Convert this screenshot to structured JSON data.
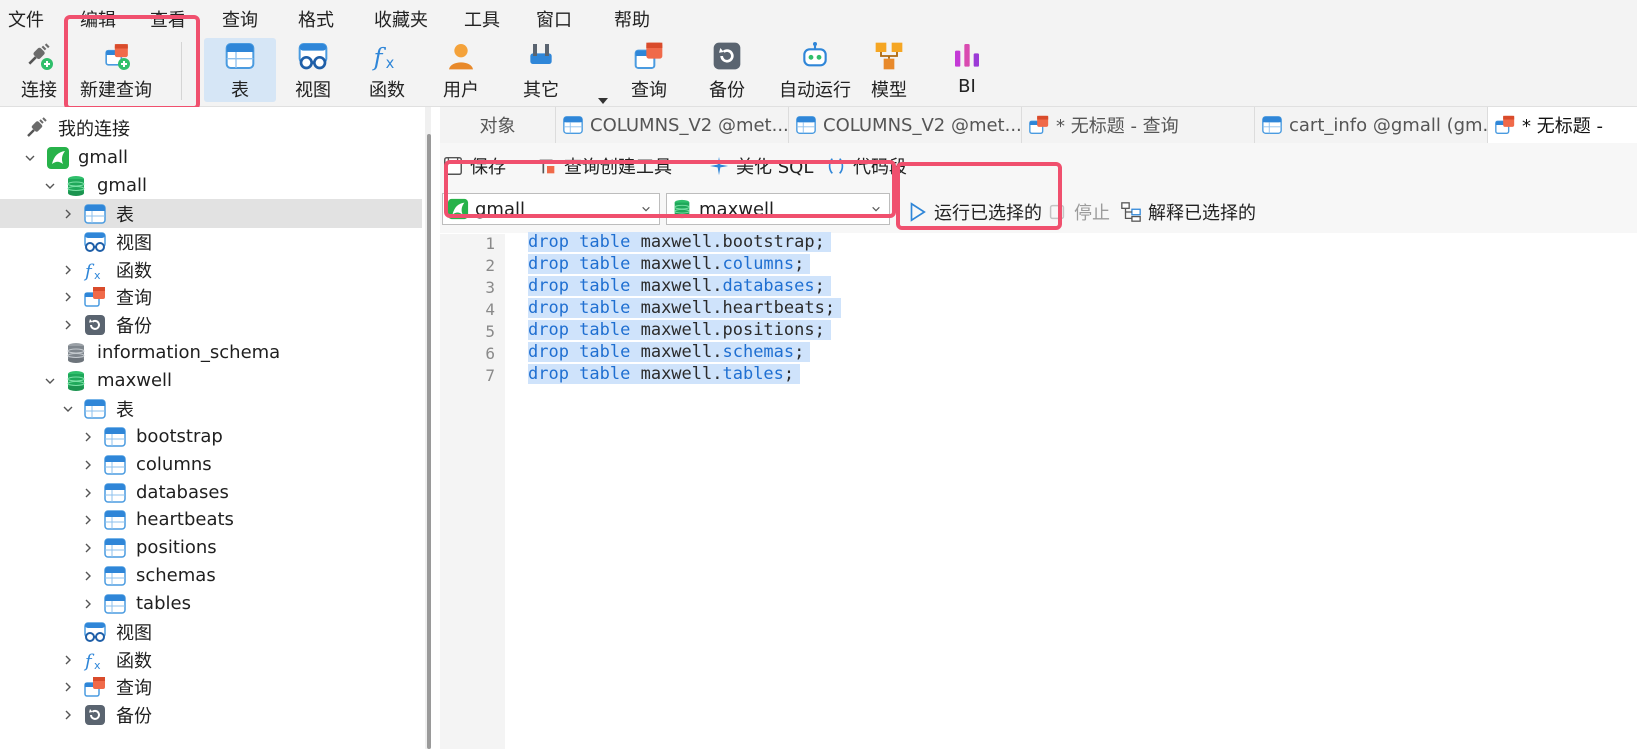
{
  "menu": [
    "文件",
    "编辑",
    "查看",
    "查询",
    "格式",
    "收藏夹",
    "工具",
    "窗口",
    "帮助"
  ],
  "toolbar": {
    "connect": "连接",
    "new_query": "新建查询",
    "table": "表",
    "view": "视图",
    "function": "函数",
    "user": "用户",
    "other": "其它",
    "query": "查询",
    "backup": "备份",
    "auto_run": "自动运行",
    "model": "模型",
    "bi": "BI"
  },
  "sidebar": {
    "root": "我的连接",
    "conn": "gmall",
    "db_gmall": "gmall",
    "tables": "表",
    "views": "视图",
    "functions": "函数",
    "queries": "查询",
    "backups": "备份",
    "info_schema": "information_schema",
    "db_maxwell": "maxwell",
    "mx_tables": "表",
    "mx_table_list": [
      "bootstrap",
      "columns",
      "databases",
      "heartbeats",
      "positions",
      "schemas",
      "tables"
    ],
    "mx_views": "视图",
    "mx_functions": "函数",
    "mx_queries": "查询",
    "mx_backups": "备份"
  },
  "tabs": [
    "对象",
    "COLUMNS_V2 @met...",
    "COLUMNS_V2 @met...",
    "* 无标题 - 查询",
    "cart_info @gmall (gm...",
    "* 无标题 -"
  ],
  "query_toolbar": {
    "save": "保存",
    "builder": "查询创建工具",
    "beautify": "美化 SQL",
    "snippet": "代码段"
  },
  "query_bar": {
    "connection": "gmall",
    "database": "maxwell",
    "run_selected": "运行已选择的",
    "stop": "停止",
    "explain_selected": "解释已选择的"
  },
  "editor": {
    "lines": [
      {
        "n": "1",
        "kw": "drop table",
        "obj": "maxwell.",
        "name": "bootstrap",
        "name_kw": false
      },
      {
        "n": "2",
        "kw": "drop table",
        "obj": "maxwell.",
        "name": "columns",
        "name_kw": true
      },
      {
        "n": "3",
        "kw": "drop table",
        "obj": "maxwell.",
        "name": "databases",
        "name_kw": true
      },
      {
        "n": "4",
        "kw": "drop table",
        "obj": "maxwell.",
        "name": "heartbeats",
        "name_kw": false
      },
      {
        "n": "5",
        "kw": "drop table",
        "obj": "maxwell.",
        "name": "positions",
        "name_kw": false
      },
      {
        "n": "6",
        "kw": "drop table",
        "obj": "maxwell.",
        "name": "schemas",
        "name_kw": true
      },
      {
        "n": "7",
        "kw": "drop table",
        "obj": "maxwell.",
        "name": "tables",
        "name_kw": true
      }
    ]
  },
  "colors": {
    "highlight_box": "#f0506e",
    "keyword": "#1f6fd1",
    "selection": "#cfe3fb"
  }
}
